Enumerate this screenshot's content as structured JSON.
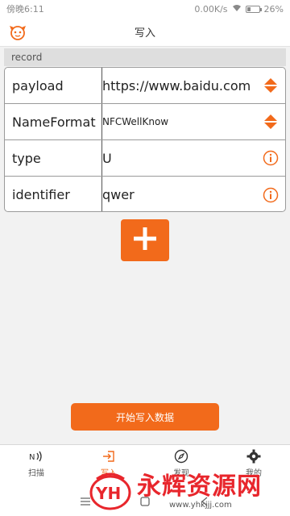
{
  "status_bar": {
    "time": "傍晚6:11",
    "network": "0.00K/s",
    "battery": "26%",
    "battery_level": 0.26
  },
  "app_bar": {
    "title": "写入"
  },
  "section": {
    "title": "record"
  },
  "record": {
    "rows": [
      {
        "label": "payload",
        "value": "https://www.baidu.com",
        "tool": "sort-icon"
      },
      {
        "label": "NameFormat",
        "value": "NFCWellKnow",
        "tool": "sort-icon"
      },
      {
        "label": "type",
        "value": "U",
        "tool": "info-icon"
      },
      {
        "label": "identifier",
        "value": "qwer",
        "tool": "info-icon"
      }
    ]
  },
  "add_button": {
    "icon": "plus-icon"
  },
  "start_button": {
    "label": "开始写入数据"
  },
  "bottom_nav": {
    "items": [
      {
        "label": "扫描",
        "icon": "nfc-icon"
      },
      {
        "label": "写入",
        "icon": "login-icon",
        "active": true
      },
      {
        "label": "发现",
        "icon": "compass-icon"
      },
      {
        "label": "我的",
        "icon": "gear-icon"
      }
    ]
  },
  "watermark": {
    "text": "永辉资源网",
    "url": "www.yhkjjj.com",
    "logo_text": "YH"
  },
  "colors": {
    "accent": "#f26a1b",
    "watermark": "#e8262c"
  }
}
